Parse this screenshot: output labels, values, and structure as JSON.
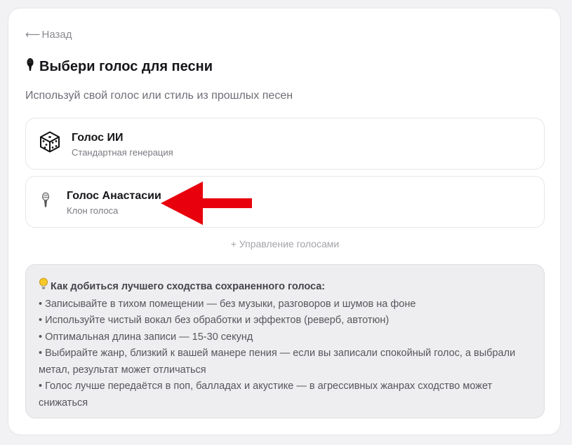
{
  "nav": {
    "back_arrow": "⟵",
    "back_label": "Назад"
  },
  "header": {
    "title": "Выбери голос для песни",
    "subtitle": "Используй свой голос или стиль из прошлых песен"
  },
  "voices": [
    {
      "name": "Голос ИИ",
      "description": "Стандартная генерация",
      "icon": "dice-icon"
    },
    {
      "name": "Голос Анастасии",
      "description": "Клон голоса",
      "icon": "microphone-icon"
    }
  ],
  "manage_label": "+ Управление голосами",
  "tips": {
    "heading": "Как добиться лучшего сходства сохраненного голоса:",
    "items": [
      "Записывайте в тихом помещении — без музыки, разговоров и шумов на фоне",
      "Используйте чистый вокал без обработки и эффектов (реверб, автотюн)",
      "Оптимальная длина записи — 15-30 секунд",
      "Выбирайте жанр, близкий к вашей манере пения — если вы записали спокойный голос, а выбрали метал, результат может отличаться",
      "Голос лучше передаётся в поп, балладах и акустике — в агрессивных жанрах сходство может снижаться"
    ]
  },
  "colors": {
    "accent_arrow": "#e8000d",
    "tips_background": "#eeeef0"
  }
}
